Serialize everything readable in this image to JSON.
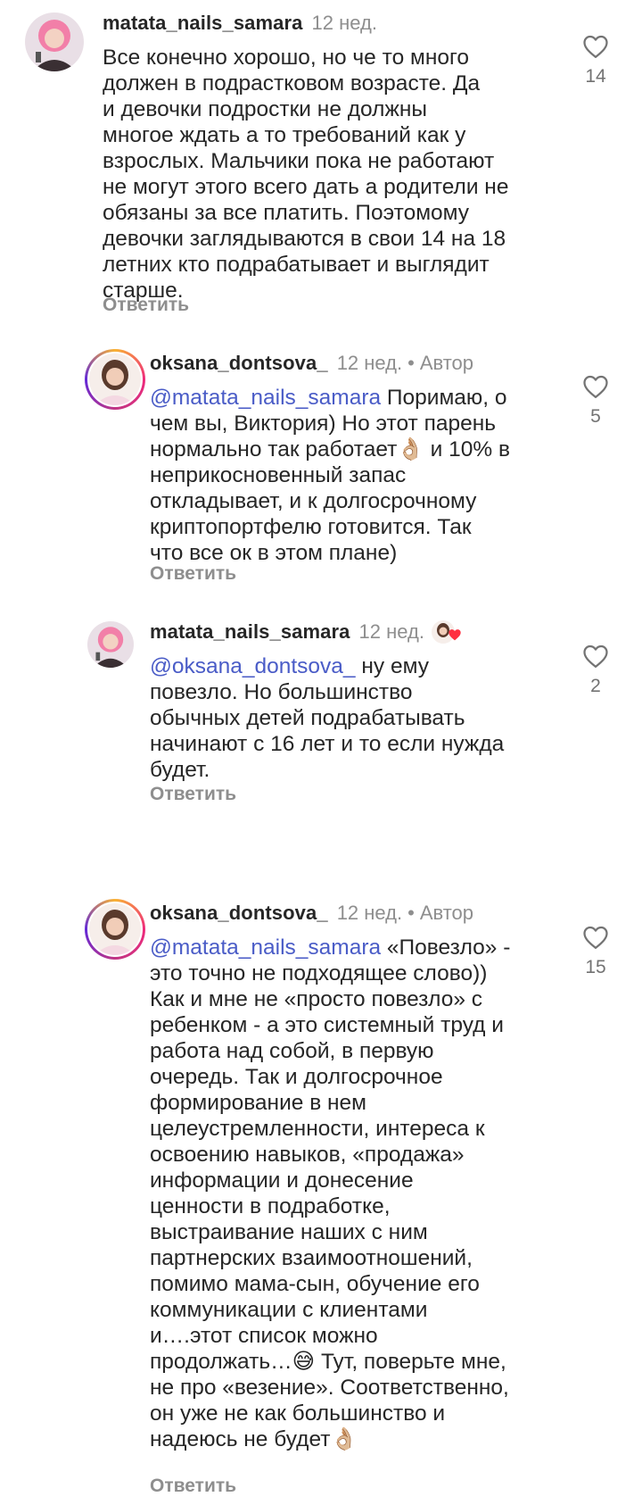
{
  "comments": [
    {
      "username": "matata_nails_samara",
      "time": "12 нед.",
      "mention": "",
      "body": "Все конечно хорошо, но че то много\nдолжен в подрастковом возрасте.  Да\nи девочки подростки не должны\nмногое ждать а то требований как у\nвзрослых. Мальчики пока не работают\nне могут этого всего дать а родители не\nобязаны за все платить. Поэтомому\nдевочки заглядываются в свои 14 на 18\nлетних кто подрабатывает и выглядит\nстарше.",
      "reply_label": "Ответить",
      "likes": "14"
    },
    {
      "username": "oksana_dontsova_",
      "time": "12 нед.",
      "separator": "•",
      "author_badge": "Автор",
      "mention": "@matata_nails_samara",
      "body_first": " Поримаю, о",
      "body": "чем вы, Виктория) Но этот парень\nнормально так работает👌🏼 и 10% в\nнеприкосновенный запас\nоткладывает, и к долгосрочному\nкриптопортфелю готовится. Так\nчто все ок в этом плане)",
      "reply_label": "Ответить",
      "likes": "5"
    },
    {
      "username": "matata_nails_samara",
      "time": "12 нед.",
      "mention": "@oksana_dontsova_",
      "body_first": " ну ему",
      "body": "повезло. Но большинство\nобычных детей подрабатывать\nначинают с 16 лет и то если нужда\nбудет.",
      "reply_label": "Ответить",
      "likes": "2"
    },
    {
      "username": "oksana_dontsova_",
      "time": "12 нед.",
      "separator": "•",
      "author_badge": "Автор",
      "mention": "@matata_nails_samara",
      "body_first": " «Повезло» -",
      "body": "это точно не подходящее слово))\nКак и мне не «просто повезло» с\nребенком - а это системный труд и\nработа над собой, в первую\nочередь. Так и долгосрочное\nформирование в нем\nцелеустремленности, интереса к\nосвоению навыков, «продажа»\nинформации и донесение\nценности в подработке,\nвыстраивание наших с ним\nпартнерских взаимоотношений,\nпомимо мама-сын, обучение его\nкоммуникации с клиентами\nи….этот список можно\nпродолжать…😅 Тут, поверьте мне,\nне про «везение». Соответственно,\nон уже не как большинство и\nнадеюсь не будет👌🏼",
      "reply_label": "Ответить",
      "likes": "15"
    }
  ],
  "colors": {
    "mention": "#4a5cc7",
    "secondary": "#8e8e8e",
    "liked_heart": "#ff3040"
  },
  "icons": [
    "heart-outline-icon",
    "liked-by-author-icon"
  ]
}
